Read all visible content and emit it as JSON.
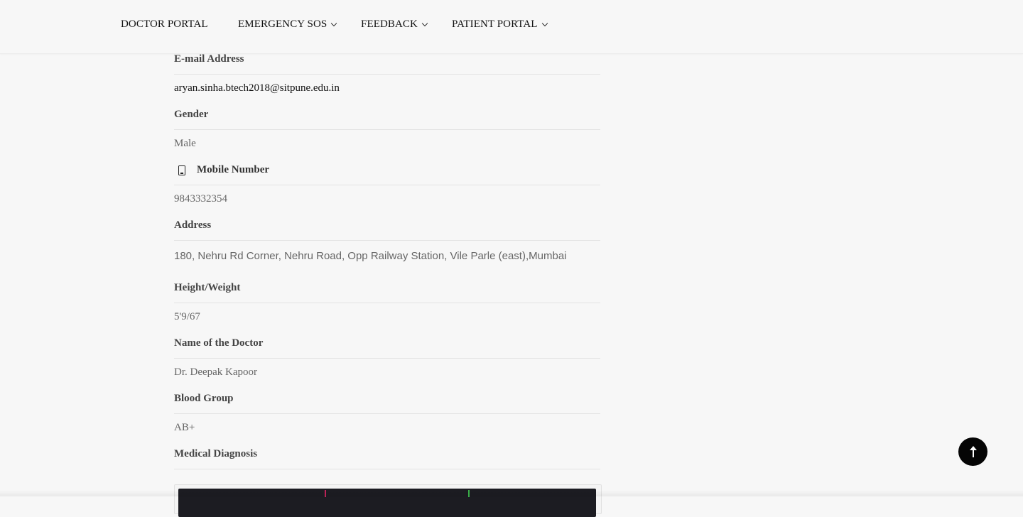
{
  "nav": {
    "items": [
      {
        "label": "DOCTOR PORTAL",
        "has_dropdown": false
      },
      {
        "label": "EMERGENCY SOS",
        "has_dropdown": true
      },
      {
        "label": "FEEDBACK",
        "has_dropdown": true
      },
      {
        "label": "PATIENT PORTAL",
        "has_dropdown": true
      }
    ]
  },
  "profile": {
    "email_label": "E-mail Address",
    "email_value": "aryan.sinha.btech2018@sitpune.edu.in",
    "gender_label": "Gender",
    "gender_value": "Male",
    "mobile_label": "Mobile Number",
    "mobile_icon": "mobile-phone-icon",
    "mobile_value": "9843332354",
    "address_label": "Address",
    "address_value": "180, Nehru Rd Corner, Nehru Road, Opp Railway Station, Vile Parle (east),Mumbai",
    "height_weight_label": "Height/Weight",
    "height_weight_value": "5'9/67",
    "doctor_label": "Name of the Doctor",
    "doctor_value": "Dr. Deepak Kapoor",
    "blood_group_label": "Blood Group",
    "blood_group_value": "AB+",
    "diagnosis_label": "Medical Diagnosis"
  },
  "scroll_top": {
    "icon": "arrow-up-icon",
    "background": "#050505"
  },
  "colors": {
    "page_background": "#f7f7f7",
    "label_text": "#444444",
    "value_text": "#666666"
  }
}
